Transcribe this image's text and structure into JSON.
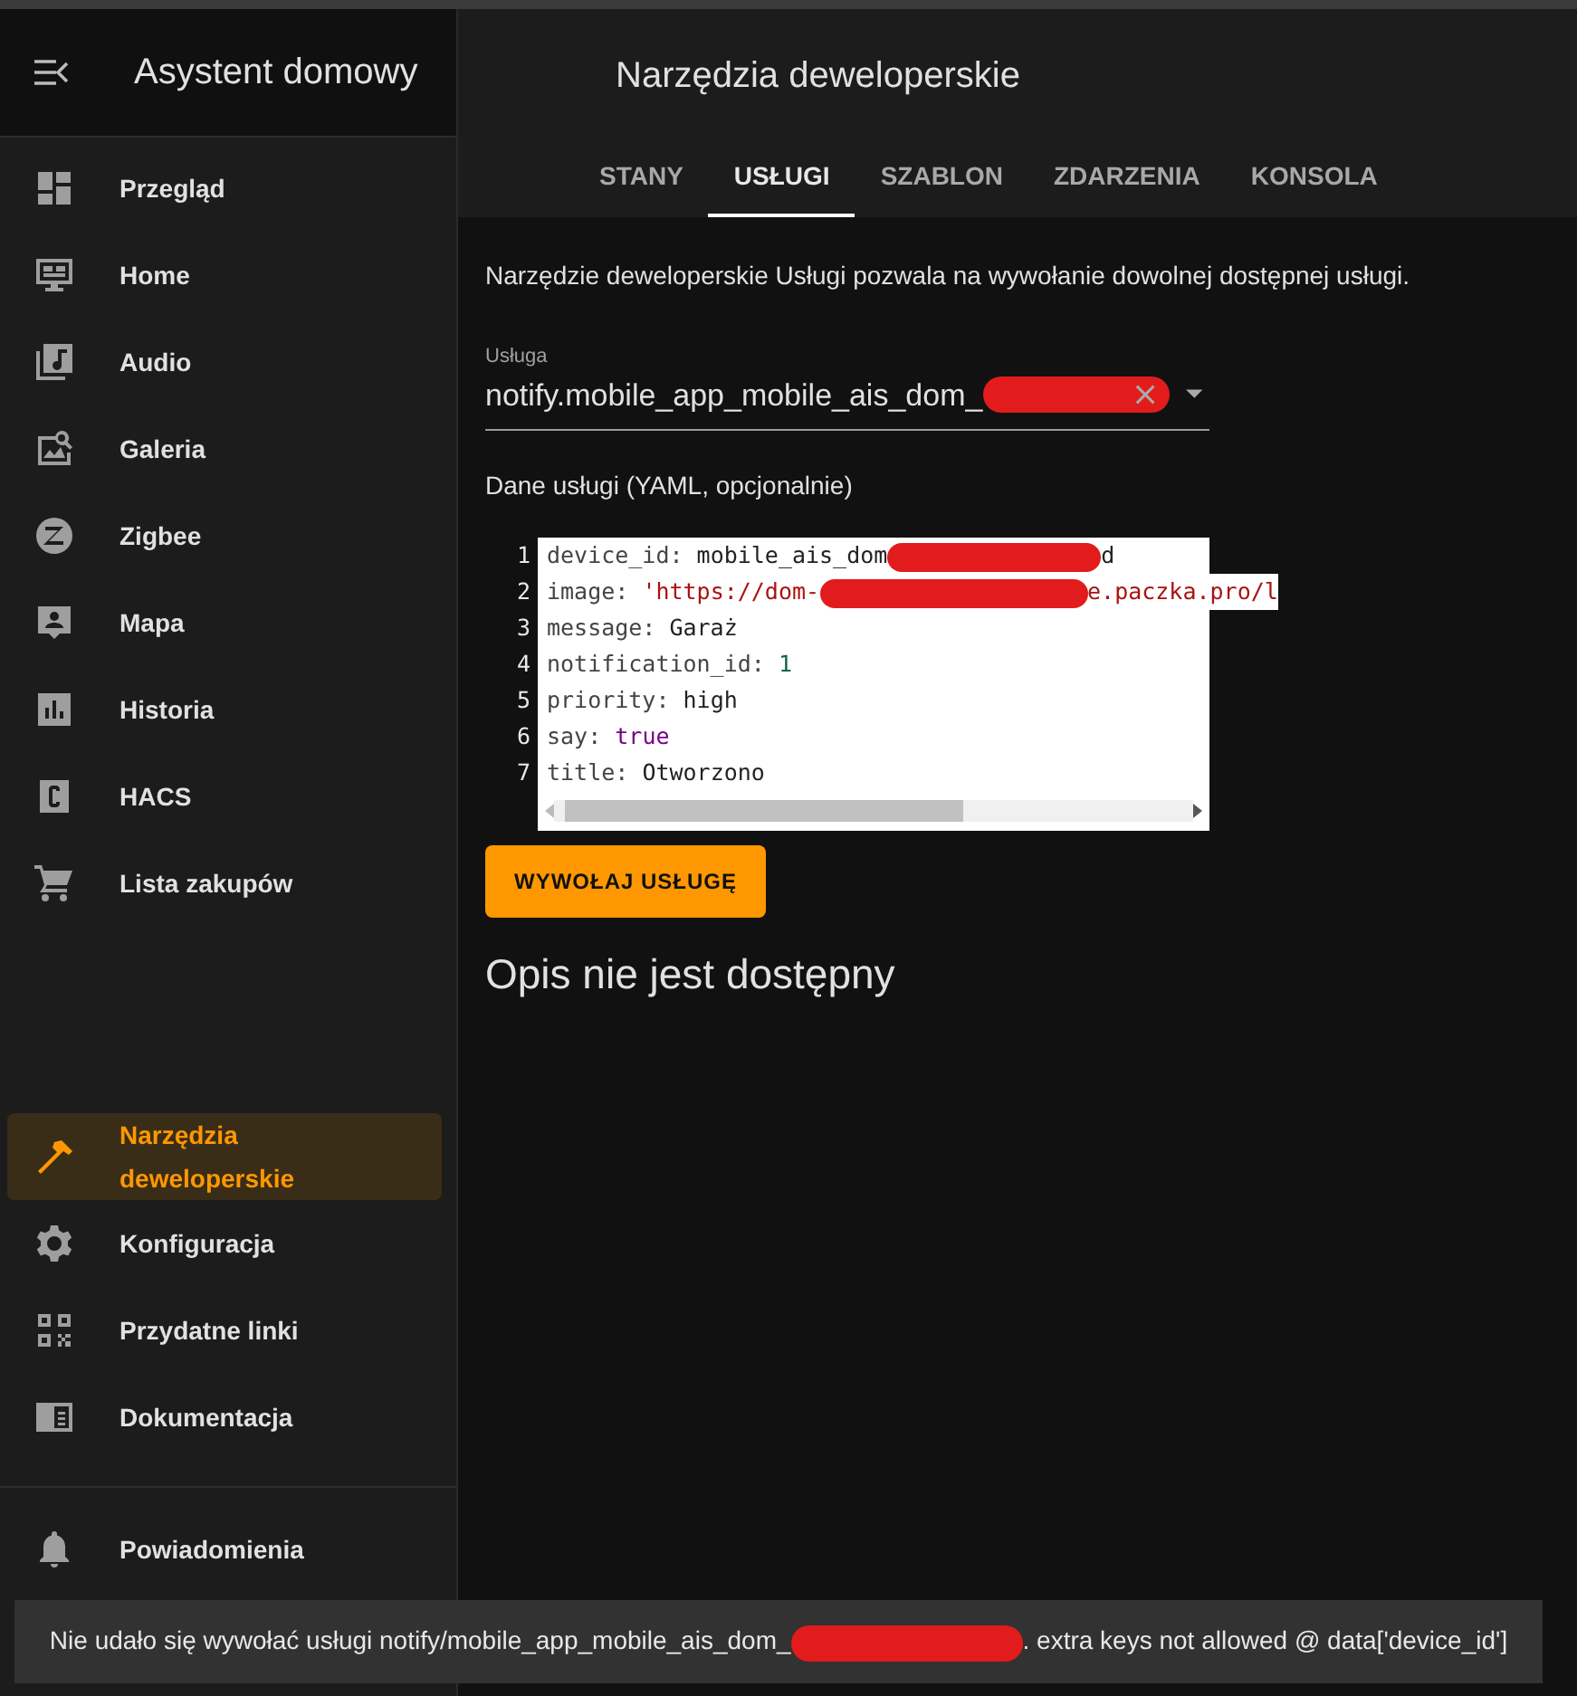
{
  "sidebar": {
    "title": "Asystent domowy",
    "items": [
      {
        "label": "Przegląd",
        "selected": false
      },
      {
        "label": "Home",
        "selected": false
      },
      {
        "label": "Audio",
        "selected": false
      },
      {
        "label": "Galeria",
        "selected": false
      },
      {
        "label": "Zigbee",
        "selected": false
      },
      {
        "label": "Mapa",
        "selected": false
      },
      {
        "label": "Historia",
        "selected": false
      },
      {
        "label": "HACS",
        "selected": false
      },
      {
        "label": "Lista zakupów",
        "selected": false
      }
    ],
    "bottom_items": [
      {
        "label": "Narzędzia deweloperskie",
        "selected": true
      },
      {
        "label": "Konfiguracja",
        "selected": false
      },
      {
        "label": "Przydatne linki",
        "selected": false
      },
      {
        "label": "Dokumentacja",
        "selected": false
      }
    ],
    "notifications": {
      "label": "Powiadomienia"
    }
  },
  "header": {
    "title": "Narzędzia deweloperskie"
  },
  "tabs": [
    {
      "label": "STANY",
      "selected": false
    },
    {
      "label": "USŁUGI",
      "selected": true
    },
    {
      "label": "SZABLON",
      "selected": false
    },
    {
      "label": "ZDARZENIA",
      "selected": false
    },
    {
      "label": "KONSOLA",
      "selected": false
    }
  ],
  "intro": "Narzędzie deweloperskie Usługi pozwala na wywołanie dowolnej dostępnej usługi.",
  "service_field": {
    "label": "Usługa",
    "value": "notify.mobile_app_mobile_ais_dom_",
    "redacted": true
  },
  "yaml_label": "Dane usługi (YAML, opcjonalnie)",
  "code_lines": [
    {
      "number": "1",
      "key": "device_id",
      "sep": ": ",
      "value": "mobile_ais_dom",
      "kind": "plain",
      "redacted": true,
      "tail": "d"
    },
    {
      "number": "2",
      "key": "image",
      "sep": ": ",
      "value": "'https://dom-",
      "kind": "string",
      "redacted": true,
      "tail": "e.paczka.pro/l"
    },
    {
      "number": "3",
      "key": "message",
      "sep": ": ",
      "value": "Garaż",
      "kind": "plain"
    },
    {
      "number": "4",
      "key": "notification_id",
      "sep": ": ",
      "value": "1",
      "kind": "number"
    },
    {
      "number": "5",
      "key": "priority",
      "sep": ": ",
      "value": "high",
      "kind": "plain"
    },
    {
      "number": "6",
      "key": "say",
      "sep": ": ",
      "value": "true",
      "kind": "bool"
    },
    {
      "number": "7",
      "key": "title",
      "sep": ": ",
      "value": "Otworzono",
      "kind": "plain"
    }
  ],
  "call_button": "WYWOŁAJ USŁUGĘ",
  "description": "Opis nie jest dostępny",
  "toast": {
    "text": "Nie udało się wywołać usługi notify/mobile_app_mobile_ais_dom_",
    "redacted": true,
    "tail": ". extra keys not allowed @ data['device_id']"
  }
}
